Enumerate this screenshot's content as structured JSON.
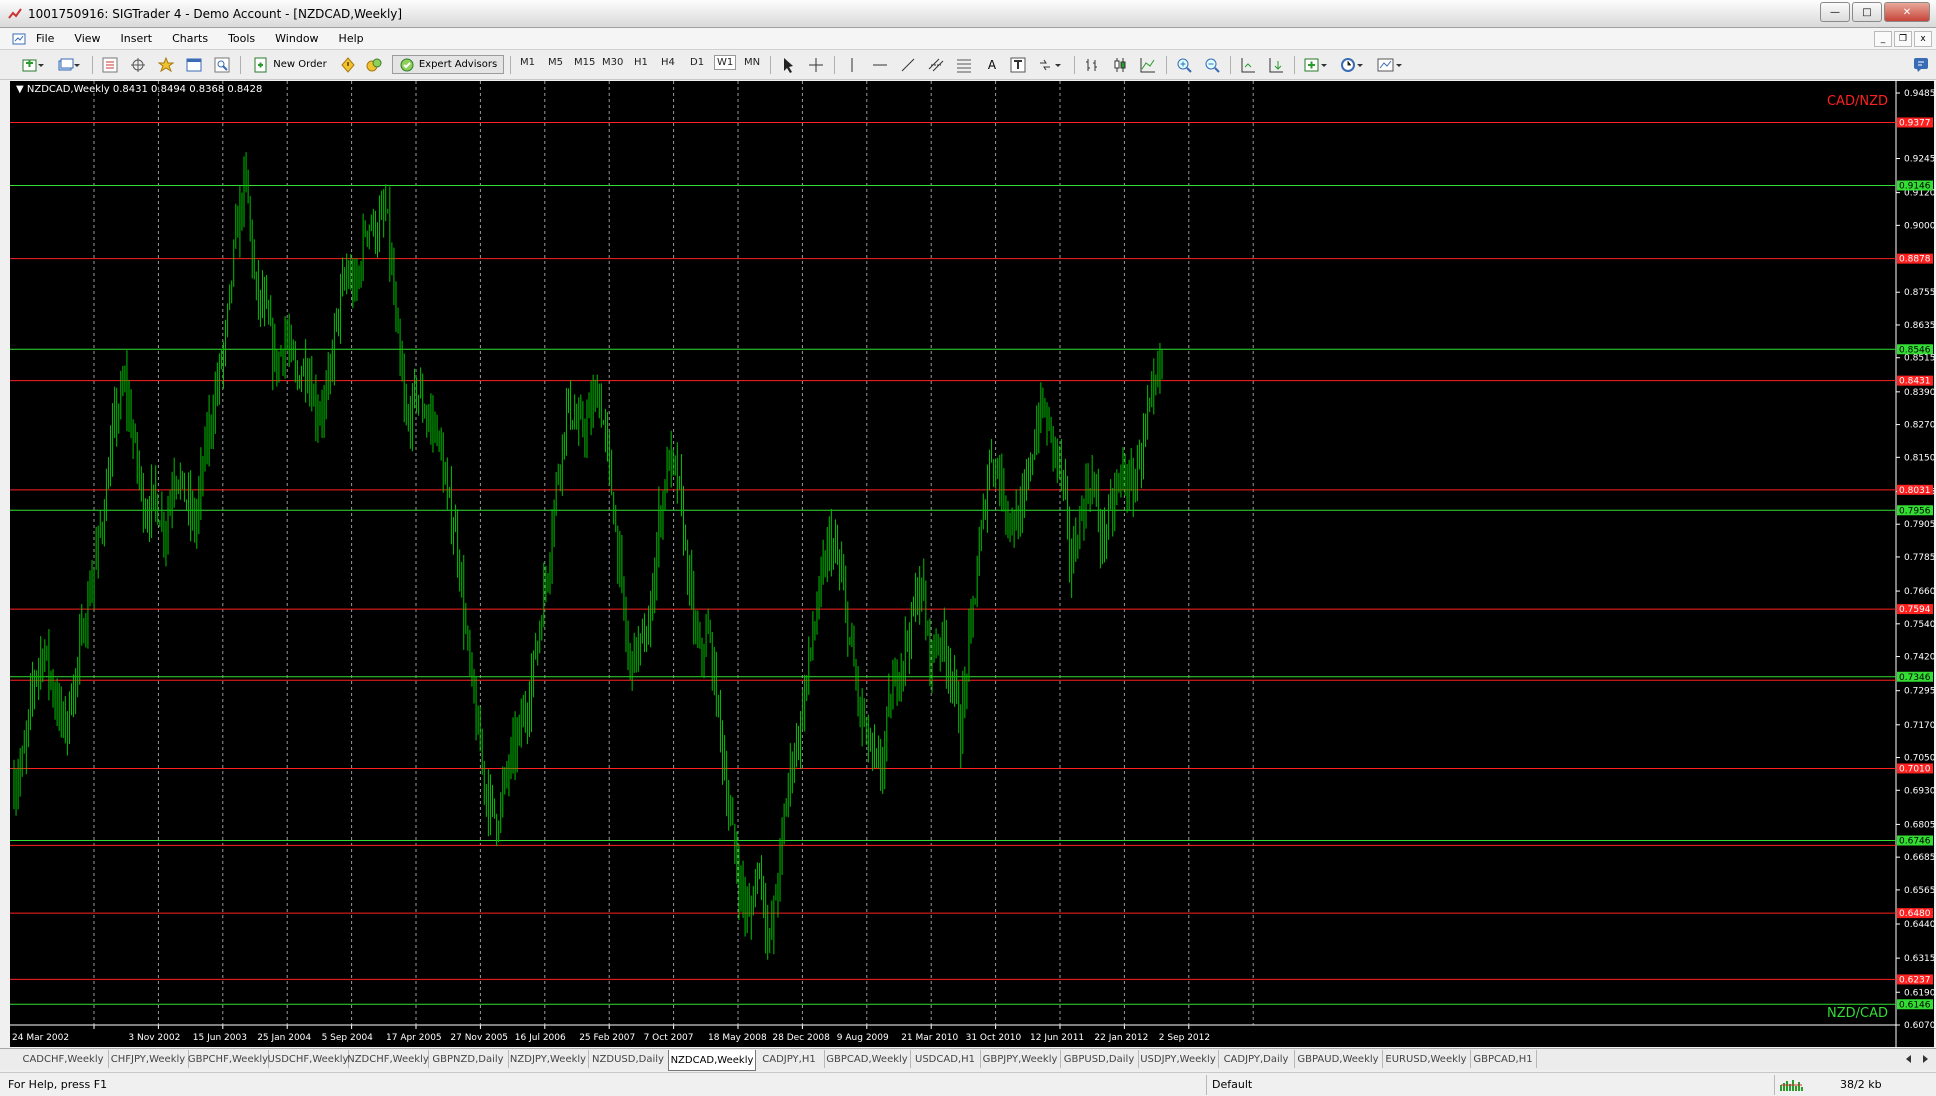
{
  "window": {
    "title": "1001750916: SIGTrader 4 - Demo Account - [NZDCAD,Weekly]"
  },
  "menu": [
    "File",
    "View",
    "Insert",
    "Charts",
    "Tools",
    "Window",
    "Help"
  ],
  "toolbar": {
    "new_order": "New Order",
    "expert_advisors": "Expert Advisors",
    "timeframes": [
      "M1",
      "M5",
      "M15",
      "M30",
      "H1",
      "H4",
      "D1",
      "W1",
      "MN"
    ],
    "active_timeframe": "W1"
  },
  "chart": {
    "header": "NZDCAD,Weekly  0.8431 0.8494 0.8368 0.8428",
    "label_top": "CAD/NZD",
    "label_bottom": "NZD/CAD",
    "bg": "#000000",
    "candle_color": "#00c000",
    "y_min": 0.607,
    "y_max": 0.9485,
    "price_ticks": [
      "0.9485",
      "0.9245",
      "0.9120",
      "0.9000",
      "0.8755",
      "0.8635",
      "0.8515",
      "0.8390",
      "0.8270",
      "0.8150",
      "0.8025",
      "0.7905",
      "0.7785",
      "0.7660",
      "0.7540",
      "0.7420",
      "0.7295",
      "0.7170",
      "0.7050",
      "0.6930",
      "0.6805",
      "0.6685",
      "0.6565",
      "0.6440",
      "0.6315",
      "0.6190",
      "0.6070"
    ],
    "date_labels": [
      "24 Mar 2002",
      "3 Nov 2002",
      "15 Jun 2003",
      "25 Jan 2004",
      "5 Sep 2004",
      "17 Apr 2005",
      "27 Nov 2005",
      "16 Jul 2006",
      "25 Feb 2007",
      "7 Oct 2007",
      "18 May 2008",
      "28 Dec 2008",
      "9 Aug 2009",
      "21 Mar 2010",
      "31 Oct 2010",
      "12 Jun 2011",
      "22 Jan 2012",
      "2 Sep 2012"
    ],
    "levels": [
      {
        "price": 0.9377,
        "label": "0.9377",
        "color": "#ff2020"
      },
      {
        "price": 0.9146,
        "label": "0.9146",
        "color": "#33dd33"
      },
      {
        "price": 0.8878,
        "label": "0.8878",
        "color": "#ff2020"
      },
      {
        "price": 0.8546,
        "label": "0.8546",
        "color": "#33dd33"
      },
      {
        "price": 0.8431,
        "label": "0.8431",
        "color": "#ff2020"
      },
      {
        "price": 0.8031,
        "label": "0.8031",
        "color": "#ff2020"
      },
      {
        "price": 0.7956,
        "label": "0.7956",
        "color": "#33dd33"
      },
      {
        "price": 0.7594,
        "label": "0.7594",
        "color": "#ff2020"
      },
      {
        "price": 0.7346,
        "label": "0.7346",
        "color": "#33dd33"
      },
      {
        "price": 0.7333,
        "label": "",
        "color": "#ff2020"
      },
      {
        "price": 0.701,
        "label": "0.7010",
        "color": "#ff2020"
      },
      {
        "price": 0.6746,
        "label": "0.6746",
        "color": "#33dd33"
      },
      {
        "price": 0.6728,
        "label": "",
        "color": "#ff2020"
      },
      {
        "price": 0.648,
        "label": "0.6480",
        "color": "#ff2020"
      },
      {
        "price": 0.6237,
        "label": "0.6237",
        "color": "#ff2020"
      },
      {
        "price": 0.6146,
        "label": "0.6146",
        "color": "#33dd33"
      }
    ],
    "path": [
      0.695,
      0.705,
      0.735,
      0.745,
      0.728,
      0.715,
      0.732,
      0.755,
      0.775,
      0.798,
      0.828,
      0.842,
      0.818,
      0.795,
      0.8,
      0.788,
      0.812,
      0.8,
      0.79,
      0.818,
      0.838,
      0.858,
      0.895,
      0.918,
      0.875,
      0.868,
      0.848,
      0.86,
      0.843,
      0.85,
      0.832,
      0.835,
      0.865,
      0.882,
      0.876,
      0.902,
      0.898,
      0.905,
      0.86,
      0.825,
      0.84,
      0.83,
      0.825,
      0.8,
      0.785,
      0.745,
      0.715,
      0.69,
      0.682,
      0.7,
      0.712,
      0.725,
      0.748,
      0.775,
      0.81,
      0.835,
      0.825,
      0.828,
      0.84,
      0.815,
      0.78,
      0.74,
      0.745,
      0.75,
      0.79,
      0.815,
      0.805,
      0.77,
      0.742,
      0.75,
      0.72,
      0.685,
      0.66,
      0.645,
      0.668,
      0.635,
      0.665,
      0.7,
      0.715,
      0.742,
      0.765,
      0.785,
      0.774,
      0.748,
      0.722,
      0.708,
      0.698,
      0.725,
      0.74,
      0.752,
      0.77,
      0.742,
      0.75,
      0.738,
      0.715,
      0.752,
      0.785,
      0.818,
      0.805,
      0.792,
      0.792,
      0.815,
      0.834,
      0.823,
      0.81,
      0.775,
      0.795,
      0.808,
      0.785,
      0.795,
      0.81,
      0.802,
      0.82,
      0.834,
      0.85
    ]
  },
  "tabs": [
    "CADCHF,Weekly",
    "CHFJPY,Weekly",
    "GBPCHF,Weekly",
    "USDCHF,Weekly",
    "NZDCHF,Weekly",
    "GBPNZD,Daily",
    "NZDJPY,Weekly",
    "NZDUSD,Daily",
    "NZDCAD,Weekly",
    "CADJPY,H1",
    "GBPCAD,Weekly",
    "USDCAD,H1",
    "GBPJPY,Weekly",
    "GBPUSD,Daily",
    "USDJPY,Weekly",
    "CADJPY,Daily",
    "GBPAUD,Weekly",
    "EURUSD,Weekly",
    "GBPCAD,H1"
  ],
  "active_tab": "NZDCAD,Weekly",
  "status": {
    "help": "For Help, press F1",
    "profile": "Default",
    "traffic": "38/2 kb"
  }
}
